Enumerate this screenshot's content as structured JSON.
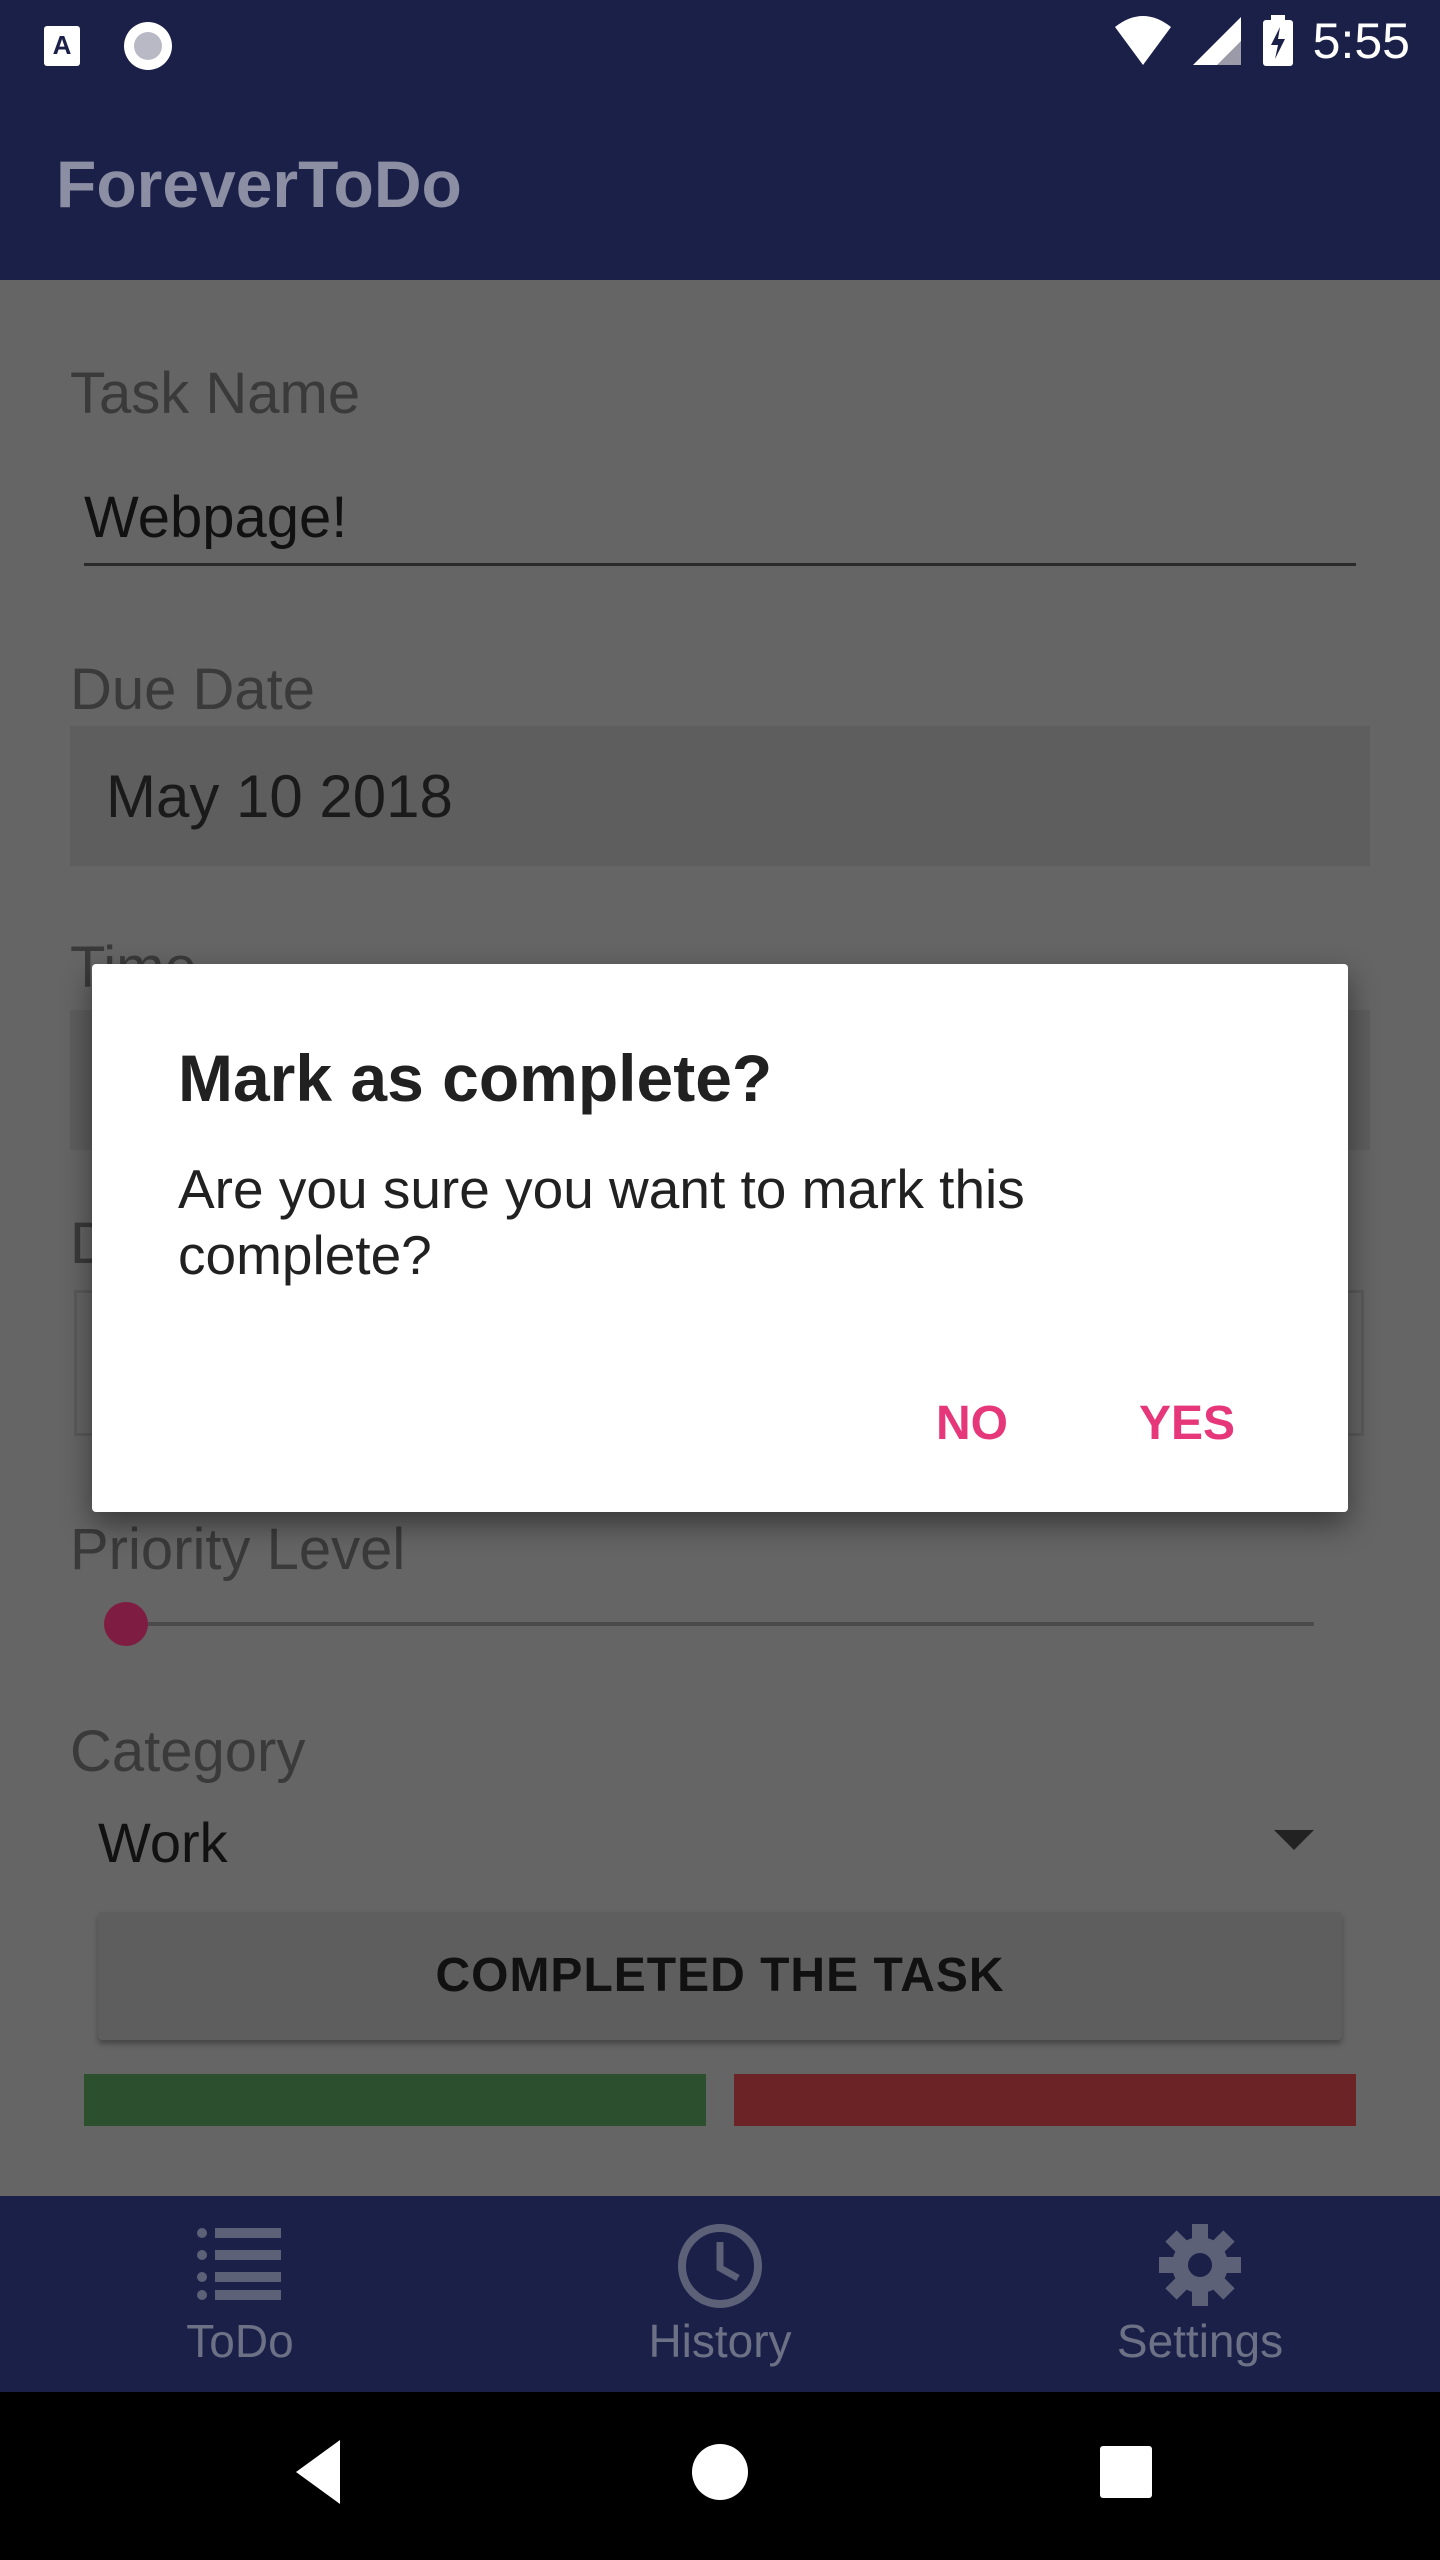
{
  "status_bar": {
    "time": "5:55",
    "icons": [
      "accessibility-a-icon",
      "circle-record-icon",
      "wifi-icon",
      "cell-signal-icon",
      "battery-charging-icon"
    ]
  },
  "app_bar": {
    "title": "ForeverToDo"
  },
  "form": {
    "task_name_label": "Task Name",
    "task_name_value": "Webpage!",
    "due_date_label": "Due Date",
    "due_date_value": "May 10 2018",
    "time_label": "Time",
    "description_label_partial": "D",
    "priority_label": "Priority Level",
    "priority_level": 0,
    "category_label": "Category",
    "category_value": "Work",
    "complete_button": "COMPLETED THE TASK"
  },
  "dialog": {
    "title": "Mark as complete?",
    "message": "Are you sure you want to mark this complete?",
    "no_button": "NO",
    "yes_button": "YES"
  },
  "bottom_nav": {
    "items": [
      {
        "label": "ToDo",
        "icon": "list-icon"
      },
      {
        "label": "History",
        "icon": "clock-icon"
      },
      {
        "label": "Settings",
        "icon": "gear-icon"
      }
    ]
  },
  "colors": {
    "primary": "#1b2048",
    "accent": "#e6377a",
    "success": "#2c4f2e",
    "danger": "#6b2326"
  }
}
